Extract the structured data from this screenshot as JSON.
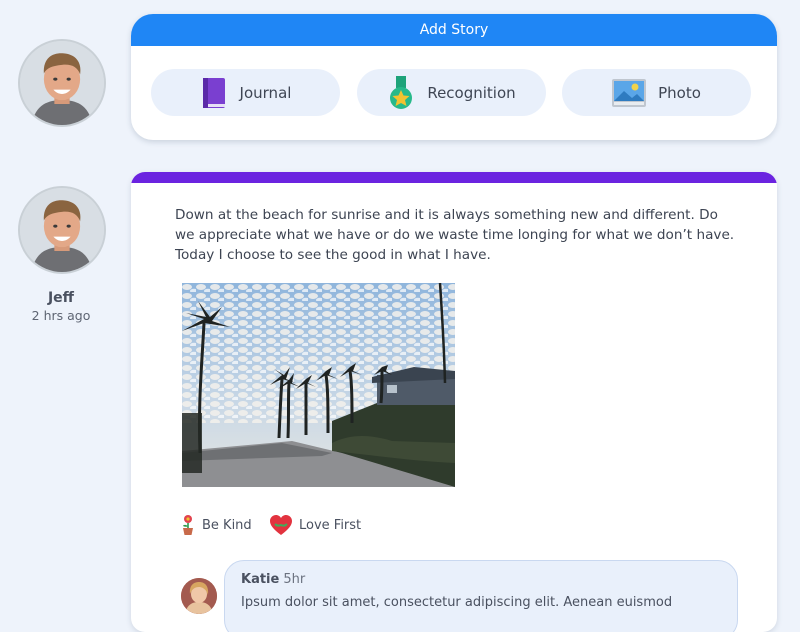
{
  "add_story": {
    "header": "Add Story",
    "options": [
      {
        "label": "Journal",
        "icon": "journal-book-icon"
      },
      {
        "label": "Recognition",
        "icon": "medal-icon"
      },
      {
        "label": "Photo",
        "icon": "photo-icon"
      }
    ]
  },
  "post": {
    "author": "Jeff",
    "time": "2 hrs ago",
    "text": "Down at the beach for sunrise and it is always something new and different.  Do we appreciate what we have or do we waste time longing for what we don’t have.  Today I choose to see the good in what I have.",
    "image": "beach-sunrise-photo",
    "tags": [
      {
        "label": "Be Kind",
        "icon": "flower-pot-icon"
      },
      {
        "label": "Love First",
        "icon": "heart-icon"
      }
    ],
    "comment": {
      "author": "Katie",
      "time": "5hr",
      "text": "Ipsum dolor sit amet, consectetur adipiscing elit. Aenean euismod"
    }
  },
  "colors": {
    "background": "#eef3fb",
    "add_story_header": "#1f86f5",
    "post_accent": "#6b23e0",
    "pill_bg": "#e9f0fb"
  }
}
